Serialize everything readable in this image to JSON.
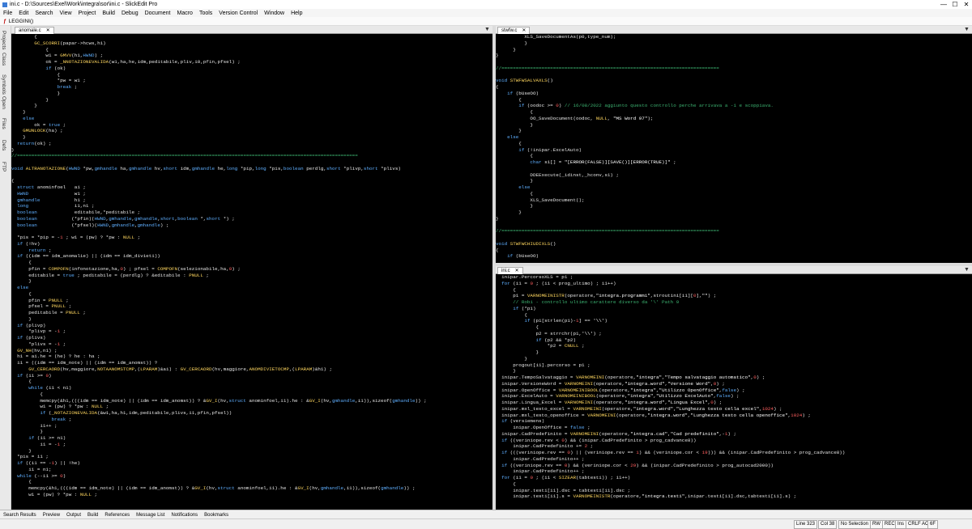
{
  "window": {
    "title": "ini.c - D:\\Sources\\Exel\\Work\\integra\\sor\\ini.c - SlickEdit Pro",
    "minimize": "—",
    "maximize": "☐",
    "close": "✕"
  },
  "menu": [
    "File",
    "Edit",
    "Search",
    "View",
    "Project",
    "Build",
    "Debug",
    "Document",
    "Macro",
    "Tools",
    "Version Control",
    "Window",
    "Help"
  ],
  "toolbar": {
    "function_icon": "ƒ",
    "current_function": "LEGGINI()"
  },
  "sidebar": [
    "Projects",
    "Class",
    "Symbols",
    "Open",
    "Files",
    "Defs",
    "FTP"
  ],
  "panes": {
    "left": {
      "tab": "anomale.c",
      "tab_close": "✕",
      "menu_arrow": "▼"
    },
    "top_right": {
      "tab": "stwfw.c",
      "tab_close": "✕",
      "menu_arrow": "▼"
    },
    "bottom_right": {
      "tab": "ini.c",
      "tab_close": "✕",
      "menu_arrow": "▼"
    }
  },
  "bottom_tabs": [
    "Search Results",
    "Preview",
    "Output",
    "Build",
    "References",
    "Message List",
    "Notifications",
    "Bookmarks"
  ],
  "status": {
    "line": "Line 323",
    "col": "Col 38",
    "selection": "No Selection",
    "rw": "RW",
    "rec": "REC",
    "ins": "Ins",
    "eol": "CRLF ACP",
    "hex": "6F"
  },
  "code": {
    "left": [
      "        {",
      "        GC_SCORRI(papar->hcws,h1)",
      "            {",
      "            w1 = GMVV(h1,HWND) ;",
      "            ok = _NNOTAZIONEVALIDA(w1,ha,he,idm,peditabile,pliv,i0,pfin,pfsel) ;",
      "            if (ok)",
      "                {",
      "                *pw = w1 ;",
      "                break ;",
      "                }",
      "            }",
      "        }",
      "    }",
      "    else",
      "        ok = true ;",
      "    GMUNLOCK(ha) ;",
      "    }",
      "  return(ok) ;",
      "}",
      "//=======================================================================================================================",
      "",
      "void ALTRANOTAZIONE(HWND *pw,gmhandle ha,gmhandle hv,short idm,gmhandle he,long *pip,long *pis,boolean perdlg,short *plivp,short *plivs)",
      "",
      "{",
      "  struct anominfoel   ai ;",
      "  HWND                w1 ;",
      "  gmhandle            h1 ;",
      "  long                i1,n1 ;",
      "  boolean             editabile,*peditabile ;",
      "  boolean            (*pfin)(HWND,gmhandle,gmhandle,short,boolean *,short *) ;",
      "  boolean            (*pfsel)(HWND,gmhandle,gmhandle) ;",
      "",
      "  *pis = *pip = -1 ; w1 = (pw) ? *pw : NULL ;",
      "  if (!hv)",
      "      return ;",
      "  if ((idm == idm_anomalie) || (idm == idm_divieti))",
      "      {",
      "      pfin = COMPOFN(infonotazione,ha,0) ; pfsel = COMPOFN(selezionabile,ha,0) ;",
      "      editabile = true ; peditabile = (perdlg) ? &editabile : PNULL ;",
      "      }",
      "  else",
      "      {",
      "      pfin = PNULL ;",
      "      pfsel = PNULL ;",
      "      peditabile = PNULL ;",
      "      }",
      "  if (plivp)",
      "      *plivp = -1 ;",
      "  if (plivs)",
      "      *plivs = -1 ;",
      "  GV_NH(hv,n1) ;",
      "  h1 = ai.he = (he) ? he : ha ;",
      "  i1 = ((idm == idm_note) || (idm == idm_anomst)) ?",
      "      GV_CERCAORD(hv,maggiore,NOTAANOMSTCMP,(LPARAM)&ai) : GV_CERCAORD(hv,maggiore,ANOMDIVIETOCMP,(LPARAM)&h1) ;",
      "  if (i1 >= 0)",
      "      {",
      "      while (i1 < n1)",
      "          {",
      "          memcpy(&h1,(((idm == idm_note) || (idm == idm_anomst)) ? &GV_I(hv,struct anominfoel,i1).he : &GV_I(hv,gmhandle,i1)),sizeof(gmhandle)) ;",
      "          w1 = (pw) ? *pw : NULL ;",
      "          if (_NOTAZIONEVALIDA(&w1,ha,h1,idm,peditabile,plivs,i1,pfin,pfsel))",
      "              break ;",
      "          i1++ ;",
      "          }",
      "      if (i1 >= n1)",
      "          i1 = -1 ;",
      "      }",
      "  *pis = i1 ;",
      "  if ((i1 == -1) || !he)",
      "      i1 = n1;",
      "  while (--i1 >= 0)",
      "      {",
      "      memcpy(&h1,(((idm == idm_note) || (idm == idm_anomst)) ? &GV_I(hv,struct anominfoel,i1).he : &GV_I(hv,gmhandle,i1)),sizeof(gmhandle)) ;",
      "      w1 = (pw) ? *pw : NULL ;"
    ],
    "top_right": [
      "          XLS_SaveDocumentAs(p0,type_num);",
      "          }",
      "      }",
      "}",
      "",
      "//============================================================================",
      "",
      "void STWFWSALVAXLS()",
      "{",
      "    if (bUseOO)",
      "        {",
      "        if (oodoc >= 0) // 16/08/2022 aggiunto questo controllo perche arrivava a -1 e scoppiava.",
      "            {",
      "            OO_SaveDocument(oodoc, NULL, \"MS Word 97\");",
      "            }",
      "        }",
      "    else",
      "        {",
      "        if (!inipar.ExcelAuto)",
      "            {",
      "            char s1[] = \"[ERROR(FALSE)][SAVE()][ERROR(TRUE)]\" ;",
      "",
      "            DDEExecute(_idinst,_hconv,s1) ;",
      "            }",
      "        else",
      "            {",
      "            XLS_SaveDocument();",
      "            }",
      "        }",
      "}",
      "",
      "//============================================================================",
      "",
      "void STWFWCHIUDIXLS()",
      "{",
      "    if (bUseOO)"
    ],
    "bottom_right": [
      "  inipar.PercorsoXLS = p1 ;",
      "  for (i1 = 0 ; (i1 < prog_ultimo) ; i1++)",
      "      {",
      "      p1 = VARNOMEINISTR(operatore,\"integra.programmi\",stroutini[i1][0],\"\") ;",
      "      // Robi - controllo ultimo carattere diverso da '\\' Path 9",
      "      if (*p1)",
      "          {",
      "          if (p1[strlen(p1)-1] == '\\\\')",
      "              {",
      "              p2 = strrchr(p1,'\\\\') ;",
      "              if (p2 && *p2)",
      "                  *p2 = CNULL ;",
      "              }",
      "          }",
      "      progout[i1].percorso = p1 ;",
      "      }",
      "  inipar.TempoSalvataggio = VARNOMEINI(operatore,\"integra\",\"Tempo salvataggio automatico\",0) ;",
      "  inipar.VersioneWord = VARNOMEINI(operatore,\"integra.word\",\"Versione Word\",0) ;",
      "  inipar.OpenOffice = VARNOMEINIBOOL(operatore,\"integra\",\"Utilizzo OpenOffice\",false) ;",
      "  inipar.ExcelAuto = VARNOMEINIBOOL(operatore,\"integra\",\"Utilizzo ExcelAuto\",false) ;",
      "  inipar.Lingua_Excel = VARNOMEINI(operatore,\"integra.word\",\"Lingua Excel\",0) ;",
      "  inipar.mxl_testo_excel = VARNOMEINI(operatore,\"integra.word\",\"Lunghezza testo cella excel\",1024) ;",
      "  inipar.mxl_testo_openoffice = VARNOMEINI(operatore,\"integra.word\",\"Lunghezza testo cella openoffice\",1024) ;",
      "  if (versiemens)",
      "      inipar.OpenOffice = false ;",
      "  inipar.CadPredefinito = VARNOMEINI(operatore,\"integra.cad\",\"Cad predefinito\",-1) ;",
      "  if ((veriniope.rev < 0) && (inipar.CadPredefinito > prog_cadvance8))",
      "      inipar.CadPredefinito += 2 ;",
      "  if (((veriniope.rev == 0) || (veriniope.rev == 1) && (veriniope.cor < 19))) && (inipar.CadPredefinito > prog_cadvance8))",
      "      inipar.CadPredefinito++ ;",
      "  if ((veriniope.rev == 0) && (veriniope.cor < 29) && (inipar.CadPredefinito > prog_autocad2000))",
      "      inipar.CadPredefinito++ ;",
      "  for (i1 = 0 ; (i1 < SIZEAR(tabtesti)) ; i1++)",
      "      {",
      "      inipar.testi[i1].dsc = tabtesti[i1].dsc ;",
      "      inipar.testi[i1].s = VARNOMEINISTR(operatore,\"integra.testi\",inipar.testi[i1].dsc,tabtesti[i1].s) ;"
    ]
  }
}
